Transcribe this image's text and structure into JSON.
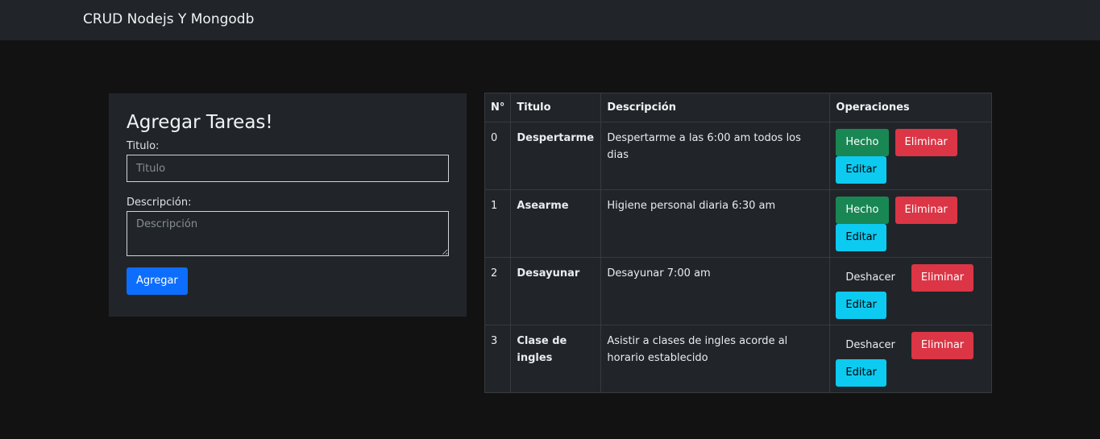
{
  "navbar": {
    "brand": "CRUD Nodejs Y Mongodb"
  },
  "form": {
    "title": "Agregar Tareas!",
    "titulo_label": "Titulo:",
    "titulo_placeholder": "Titulo",
    "descripcion_label": "Descripción:",
    "descripcion_placeholder": "Descripción",
    "submit_label": "Agregar"
  },
  "table": {
    "headers": [
      "N°",
      "Titulo",
      "Descripción",
      "Operaciones"
    ],
    "rows": [
      {
        "n": "0",
        "titulo": "Despertarme",
        "descripcion": "Despertarme a las 6:00 am todos los dias",
        "status_label": "Hecho",
        "done": false,
        "delete_label": "Eliminar",
        "edit_label": "Editar"
      },
      {
        "n": "1",
        "titulo": "Asearme",
        "descripcion": "Higiene personal diaria 6:30 am",
        "status_label": "Hecho",
        "done": false,
        "delete_label": "Eliminar",
        "edit_label": "Editar"
      },
      {
        "n": "2",
        "titulo": "Desayunar",
        "descripcion": "Desayunar 7:00 am",
        "status_label": "Deshacer",
        "done": true,
        "delete_label": "Eliminar",
        "edit_label": "Editar"
      },
      {
        "n": "3",
        "titulo": "Clase de ingles",
        "descripcion": "Asistir a clases de ingles acorde al horario establecido",
        "status_label": "Deshacer",
        "done": true,
        "delete_label": "Eliminar",
        "edit_label": "Editar"
      }
    ]
  },
  "colors": {
    "success": "#198754",
    "danger": "#dc3545",
    "info": "#0dcaf0",
    "primary": "#0d6efd"
  }
}
